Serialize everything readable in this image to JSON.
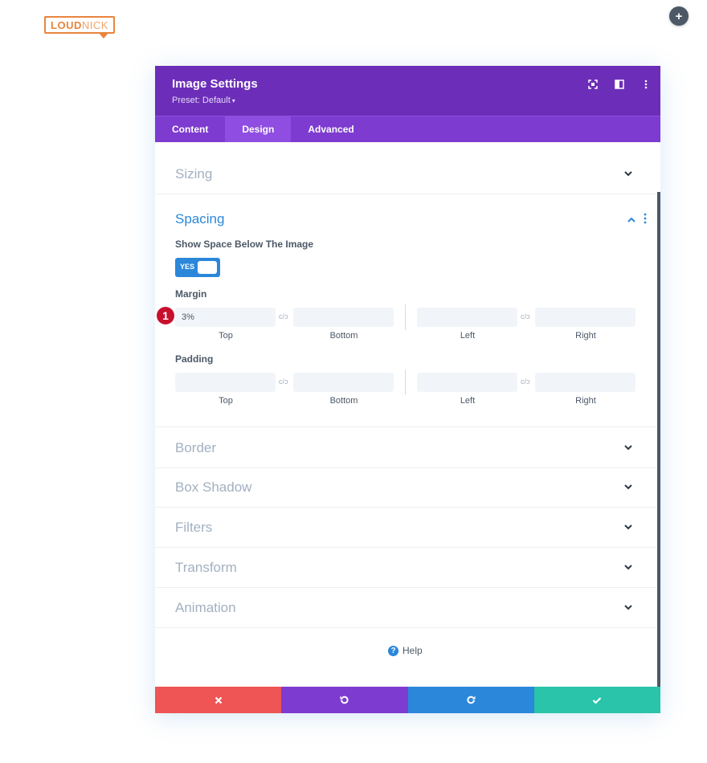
{
  "logo": {
    "text_bold": "LOUD",
    "text_rest": "NICK"
  },
  "add_button": {
    "icon": "plus-icon",
    "label": "+"
  },
  "modal": {
    "title": "Image Settings",
    "preset": "Preset: Default",
    "header_icons": [
      "focus-icon",
      "split-view-icon",
      "more-vertical-icon"
    ],
    "tabs": [
      {
        "label": "Content",
        "active": false
      },
      {
        "label": "Design",
        "active": true
      },
      {
        "label": "Advanced",
        "active": false
      }
    ],
    "sections_top": [
      {
        "label": "Sizing"
      }
    ],
    "spacing": {
      "title": "Spacing",
      "toggle_label": "Show Space Below The Image",
      "toggle_value": "YES",
      "margin": {
        "label": "Margin",
        "top": "3%",
        "bottom": "",
        "left": "",
        "right": "",
        "sublabels": [
          "Top",
          "Bottom",
          "Left",
          "Right"
        ],
        "link_icon": "c/ɔ"
      },
      "padding": {
        "label": "Padding",
        "top": "",
        "bottom": "",
        "left": "",
        "right": "",
        "sublabels": [
          "Top",
          "Bottom",
          "Left",
          "Right"
        ],
        "link_icon": "c/ɔ"
      },
      "marker_number": "1"
    },
    "sections_bottom": [
      {
        "label": "Border"
      },
      {
        "label": "Box Shadow"
      },
      {
        "label": "Filters"
      },
      {
        "label": "Transform"
      },
      {
        "label": "Animation"
      }
    ],
    "help": "Help",
    "footer": [
      {
        "name": "cancel",
        "icon": "close-icon",
        "color": "#ef5555"
      },
      {
        "name": "undo",
        "icon": "undo-icon",
        "color": "#7e3bd0"
      },
      {
        "name": "redo",
        "icon": "redo-icon",
        "color": "#2b87da"
      },
      {
        "name": "save",
        "icon": "check-icon",
        "color": "#29c4a9"
      }
    ]
  },
  "colors": {
    "header": "#6c2eb9",
    "tabs": "#7e3bd0",
    "accent_blue": "#2b87da",
    "muted_text": "#a2b0c1",
    "dark_text": "#4c5866"
  }
}
